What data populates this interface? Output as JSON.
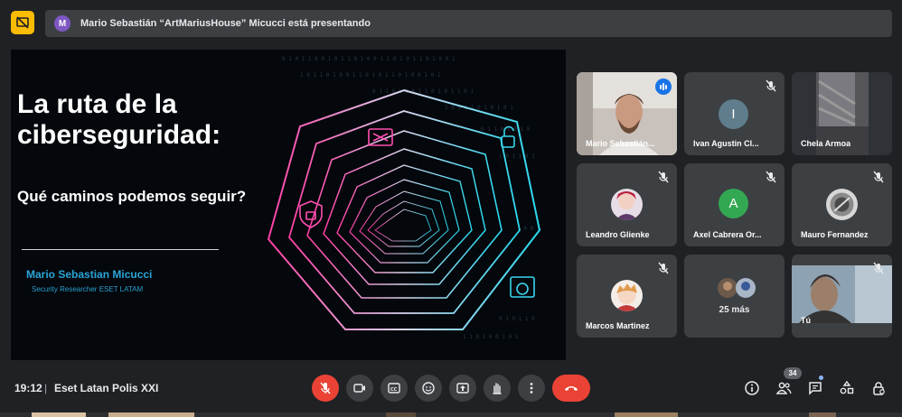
{
  "topbar": {
    "presenter_avatar_letter": "M",
    "presenting_text": "Mario Sebastián “ArtMariusHouse” Micucci está presentando"
  },
  "slide": {
    "title_line1": "La ruta de la",
    "title_line2": "ciberseguridad:",
    "subtitle": "Qué caminos podemos seguir?",
    "speaker": "Mario Sebastian Micucci",
    "role": "Security Researcher  ESET LATAM"
  },
  "participants": [
    {
      "name": "Mario Sebastián...",
      "type": "video",
      "speaking": true
    },
    {
      "name": "Ivan Agustin Cl...",
      "type": "letter",
      "letter": "I",
      "color": "#5f7d8c",
      "muted": true
    },
    {
      "name": "Chela Armoa",
      "type": "video"
    },
    {
      "name": "Leandro Glienke",
      "type": "image",
      "muted": true
    },
    {
      "name": "Axel Cabrera Or...",
      "type": "letter",
      "letter": "A",
      "color": "#33a853",
      "muted": true
    },
    {
      "name": "Mauro Fernandez",
      "type": "image",
      "muted": true
    },
    {
      "name": "Marcos Martinez",
      "type": "image",
      "muted": true
    },
    {
      "name": "25 más",
      "type": "more"
    },
    {
      "name": "Tú",
      "type": "video",
      "muted": true
    }
  ],
  "bottombar": {
    "time": "19:12",
    "separator": "|",
    "meeting_name": "Eset Latan Polis XXI",
    "participant_count": "34"
  },
  "icons": {
    "present": "present-toggle-icon",
    "mic": "mic-off-icon",
    "camera": "camera-icon",
    "captions": "captions-icon",
    "emoji": "emoji-icon",
    "present_now": "present-now-icon",
    "raise_hand": "raise-hand-icon",
    "more": "more-options-icon",
    "hangup": "hang-up-icon",
    "info": "info-icon",
    "people": "people-icon",
    "chat": "chat-icon",
    "activities": "activities-icon",
    "host_controls": "host-controls-icon"
  },
  "colors": {
    "background": "#202124",
    "surface": "#3c4043",
    "danger": "#ea4335",
    "accent": "#8ab4f8",
    "present_yellow": "#fbbc04"
  }
}
